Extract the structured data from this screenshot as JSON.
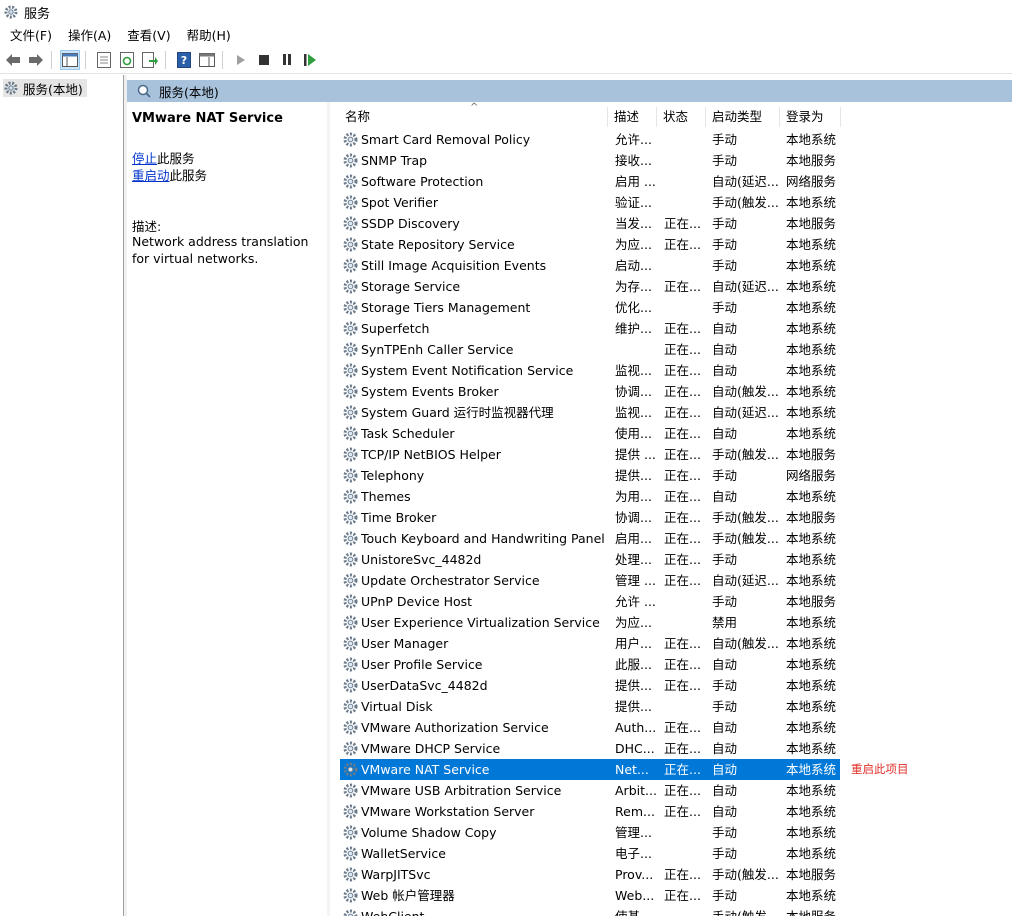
{
  "window": {
    "title": "服务",
    "icon": "services-gear-icon"
  },
  "menu": [
    "文件(F)",
    "操作(A)",
    "查看(V)",
    "帮助(H)"
  ],
  "toolbar": [
    "back-icon",
    "forward-icon",
    "show-tree-icon",
    "properties-icon",
    "refresh-icon",
    "export-icon",
    "help-icon",
    "view-icon",
    "start-icon",
    "stop-icon",
    "pause-icon",
    "restart-icon"
  ],
  "tree": {
    "root": "服务(本地)"
  },
  "header": {
    "title": "服务(本地)"
  },
  "detail": {
    "service_name": "VMware NAT Service",
    "stop_link": "停止",
    "stop_suffix": "此服务",
    "restart_link": "重启动",
    "restart_suffix": "此服务",
    "desc_label": "描述:",
    "desc_text": "Network address translation for virtual networks."
  },
  "columns": {
    "name": "名称",
    "desc": "描述",
    "status": "状态",
    "startup": "启动类型",
    "logon": "登录为"
  },
  "rows": [
    {
      "name": "Smart Card Removal Policy",
      "desc": "允许...",
      "status": "",
      "startup": "手动",
      "logon": "本地系统"
    },
    {
      "name": "SNMP Trap",
      "desc": "接收...",
      "status": "",
      "startup": "手动",
      "logon": "本地服务"
    },
    {
      "name": "Software Protection",
      "desc": "启用 ...",
      "status": "",
      "startup": "自动(延迟...",
      "logon": "网络服务"
    },
    {
      "name": "Spot Verifier",
      "desc": "验证...",
      "status": "",
      "startup": "手动(触发...",
      "logon": "本地系统"
    },
    {
      "name": "SSDP Discovery",
      "desc": "当发...",
      "status": "正在...",
      "startup": "手动",
      "logon": "本地服务"
    },
    {
      "name": "State Repository Service",
      "desc": "为应...",
      "status": "正在...",
      "startup": "手动",
      "logon": "本地系统"
    },
    {
      "name": "Still Image Acquisition Events",
      "desc": "启动...",
      "status": "",
      "startup": "手动",
      "logon": "本地系统"
    },
    {
      "name": "Storage Service",
      "desc": "为存...",
      "status": "正在...",
      "startup": "自动(延迟...",
      "logon": "本地系统"
    },
    {
      "name": "Storage Tiers Management",
      "desc": "优化...",
      "status": "",
      "startup": "手动",
      "logon": "本地系统"
    },
    {
      "name": "Superfetch",
      "desc": "维护...",
      "status": "正在...",
      "startup": "自动",
      "logon": "本地系统"
    },
    {
      "name": "SynTPEnh Caller Service",
      "desc": "",
      "status": "正在...",
      "startup": "自动",
      "logon": "本地系统"
    },
    {
      "name": "System Event Notification Service",
      "desc": "监视...",
      "status": "正在...",
      "startup": "自动",
      "logon": "本地系统"
    },
    {
      "name": "System Events Broker",
      "desc": "协调...",
      "status": "正在...",
      "startup": "自动(触发...",
      "logon": "本地系统"
    },
    {
      "name": "System Guard 运行时监视器代理",
      "desc": "监视...",
      "status": "正在...",
      "startup": "自动(延迟...",
      "logon": "本地系统"
    },
    {
      "name": "Task Scheduler",
      "desc": "使用...",
      "status": "正在...",
      "startup": "自动",
      "logon": "本地系统"
    },
    {
      "name": "TCP/IP NetBIOS Helper",
      "desc": "提供 ...",
      "status": "正在...",
      "startup": "手动(触发...",
      "logon": "本地服务"
    },
    {
      "name": "Telephony",
      "desc": "提供...",
      "status": "正在...",
      "startup": "手动",
      "logon": "网络服务"
    },
    {
      "name": "Themes",
      "desc": "为用...",
      "status": "正在...",
      "startup": "自动",
      "logon": "本地系统"
    },
    {
      "name": "Time Broker",
      "desc": "协调...",
      "status": "正在...",
      "startup": "手动(触发...",
      "logon": "本地服务"
    },
    {
      "name": "Touch Keyboard and Handwriting Panel ...",
      "desc": "启用...",
      "status": "正在...",
      "startup": "手动(触发...",
      "logon": "本地系统"
    },
    {
      "name": "UnistoreSvc_4482d",
      "desc": "处理...",
      "status": "正在...",
      "startup": "手动",
      "logon": "本地系统"
    },
    {
      "name": "Update Orchestrator Service",
      "desc": "管理 ...",
      "status": "正在...",
      "startup": "自动(延迟...",
      "logon": "本地系统"
    },
    {
      "name": "UPnP Device Host",
      "desc": "允许 ...",
      "status": "",
      "startup": "手动",
      "logon": "本地服务"
    },
    {
      "name": "User Experience Virtualization Service",
      "desc": "为应...",
      "status": "",
      "startup": "禁用",
      "logon": "本地系统"
    },
    {
      "name": "User Manager",
      "desc": "用户...",
      "status": "正在...",
      "startup": "自动(触发...",
      "logon": "本地系统"
    },
    {
      "name": "User Profile Service",
      "desc": "此服...",
      "status": "正在...",
      "startup": "自动",
      "logon": "本地系统"
    },
    {
      "name": "UserDataSvc_4482d",
      "desc": "提供...",
      "status": "正在...",
      "startup": "手动",
      "logon": "本地系统"
    },
    {
      "name": "Virtual Disk",
      "desc": "提供...",
      "status": "",
      "startup": "手动",
      "logon": "本地系统"
    },
    {
      "name": "VMware Authorization Service",
      "desc": "Auth...",
      "status": "正在...",
      "startup": "自动",
      "logon": "本地系统"
    },
    {
      "name": "VMware DHCP Service",
      "desc": "DHC...",
      "status": "正在...",
      "startup": "自动",
      "logon": "本地系统"
    },
    {
      "name": "VMware NAT Service",
      "desc": "Net...",
      "status": "正在...",
      "startup": "自动",
      "logon": "本地系统",
      "selected": true
    },
    {
      "name": "VMware USB Arbitration Service",
      "desc": "Arbit...",
      "status": "正在...",
      "startup": "自动",
      "logon": "本地系统"
    },
    {
      "name": "VMware Workstation Server",
      "desc": "Rem...",
      "status": "正在...",
      "startup": "自动",
      "logon": "本地系统"
    },
    {
      "name": "Volume Shadow Copy",
      "desc": "管理...",
      "status": "",
      "startup": "手动",
      "logon": "本地系统"
    },
    {
      "name": "WalletService",
      "desc": "电子...",
      "status": "",
      "startup": "手动",
      "logon": "本地系统"
    },
    {
      "name": "WarpJITSvc",
      "desc": "Prov...",
      "status": "正在...",
      "startup": "手动(触发...",
      "logon": "本地服务"
    },
    {
      "name": "Web 帐户管理器",
      "desc": "Web...",
      "status": "正在...",
      "startup": "手动",
      "logon": "本地系统"
    },
    {
      "name": "WebClient",
      "desc": "使基...",
      "status": "",
      "startup": "手动(触发...",
      "logon": "本地服务"
    }
  ],
  "annotation": "重启此项目",
  "colors": {
    "selection": "#0078d7",
    "header_bg": "#a8c2dc",
    "link": "#0033cc",
    "annotation": "#e0302a"
  }
}
